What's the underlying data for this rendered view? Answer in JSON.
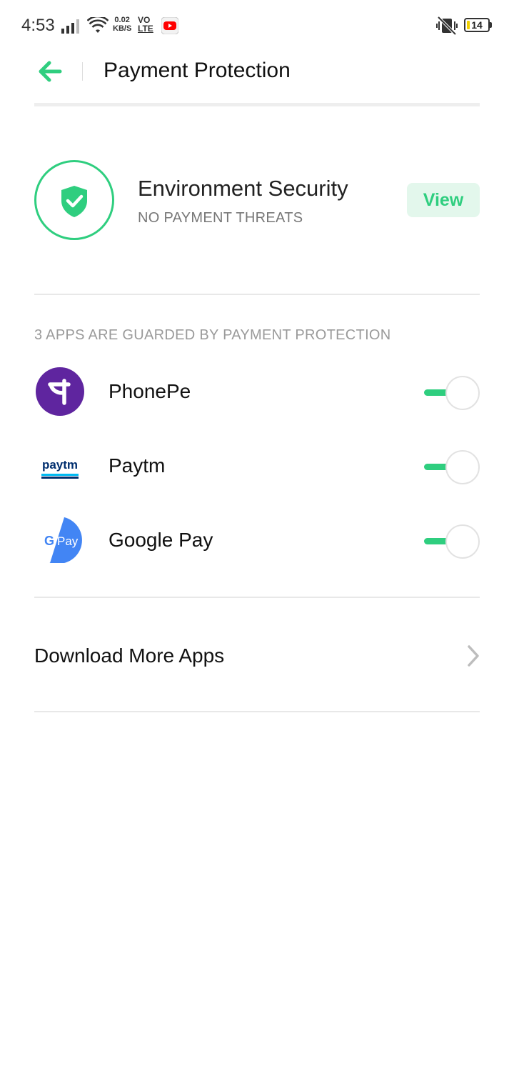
{
  "status_bar": {
    "time": "4:53",
    "net_speed_value": "0.02",
    "net_speed_unit": "KB/S",
    "volte_line1": "VO",
    "volte_line2": "LTE",
    "battery": "14",
    "battery_level": 0.14,
    "icons": [
      "signal-icon",
      "wifi-icon",
      "youtube-notification-icon",
      "vibrate-off-icon",
      "battery-icon"
    ]
  },
  "header": {
    "title": "Payment Protection",
    "back_icon": "arrow-left-icon"
  },
  "security": {
    "title": "Environment Security",
    "status": "NO PAYMENT THREATS",
    "action_label": "View",
    "icon": "shield-check-icon"
  },
  "apps_section": {
    "label": "3 APPS ARE GUARDED BY PAYMENT PROTECTION",
    "apps": [
      {
        "name": "PhonePe",
        "enabled": true,
        "icon": "phonepe-icon"
      },
      {
        "name": "Paytm",
        "enabled": true,
        "icon": "paytm-icon",
        "logo_text": "paytm"
      },
      {
        "name": "Google Pay",
        "enabled": true,
        "icon": "google-pay-icon",
        "logo_text": "Pay"
      }
    ]
  },
  "download": {
    "label": "Download More Apps",
    "icon": "chevron-right-icon"
  },
  "colors": {
    "accent": "#2fce7f",
    "accent_light": "#e3f7ec",
    "phonepe": "#5f259f",
    "paytm_dark": "#002e6e",
    "paytm_light": "#00baf2",
    "gpay_blue": "#4285f4"
  }
}
